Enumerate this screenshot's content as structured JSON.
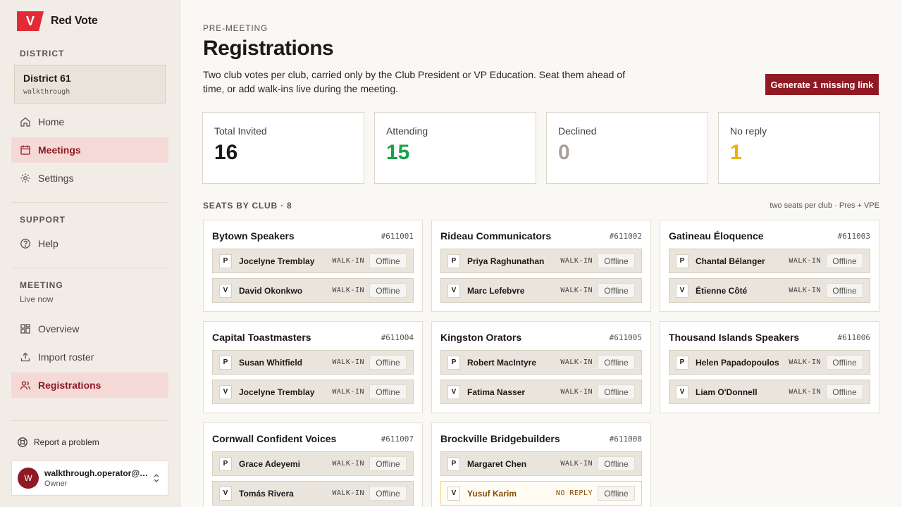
{
  "brand": {
    "logo_letter": "V",
    "name": "Red Vote",
    "color": "#e32b37"
  },
  "sidebar": {
    "district_label": "DISTRICT",
    "district": {
      "name": "District 61",
      "sub": "walkthrough"
    },
    "nav": [
      {
        "label": "Home",
        "icon": "home-icon"
      },
      {
        "label": "Meetings",
        "icon": "calendar-icon",
        "active": true
      },
      {
        "label": "Settings",
        "icon": "gear-icon"
      }
    ],
    "support_label": "SUPPORT",
    "support": [
      {
        "label": "Help",
        "icon": "help-icon"
      }
    ],
    "meeting_label": "MEETING",
    "meeting_status": "Live now",
    "meeting": [
      {
        "label": "Overview",
        "icon": "grid-icon"
      },
      {
        "label": "Import roster",
        "icon": "upload-icon"
      },
      {
        "label": "Registrations",
        "icon": "users-icon",
        "active": true
      }
    ],
    "report": "Report a problem",
    "user": {
      "initial": "W",
      "email": "walkthrough.operator@tally.example",
      "role": "Owner"
    }
  },
  "main": {
    "pre": "PRE-MEETING",
    "title": "Registrations",
    "desc": "Two club votes per club, carried only by the Club President or VP Education. Seat them ahead of time, or add walk-ins live during the meeting.",
    "generate_button": "Generate 1 missing link",
    "stats": [
      {
        "label": "Total Invited",
        "value": "16",
        "color": "#1c1917"
      },
      {
        "label": "Attending",
        "value": "15",
        "color": "#16a34a"
      },
      {
        "label": "Declined",
        "value": "0",
        "color": "#a8a29e"
      },
      {
        "label": "No reply",
        "value": "1",
        "color": "#eab308"
      }
    ],
    "seats_heading": "SEATS BY CLUB · 8",
    "seats_note": "two seats per club · Pres + VPE",
    "clubs": [
      {
        "name": "Bytown Speakers",
        "id": "#611001",
        "seats": [
          {
            "role": "P",
            "name": "Jocelyne Tremblay",
            "status": "WALK-IN",
            "conn": "Offline"
          },
          {
            "role": "V",
            "name": "David Okonkwo",
            "status": "WALK-IN",
            "conn": "Offline"
          }
        ]
      },
      {
        "name": "Rideau Communicators",
        "id": "#611002",
        "seats": [
          {
            "role": "P",
            "name": "Priya Raghunathan",
            "status": "WALK-IN",
            "conn": "Offline"
          },
          {
            "role": "V",
            "name": "Marc Lefebvre",
            "status": "WALK-IN",
            "conn": "Offline"
          }
        ]
      },
      {
        "name": "Gatineau Éloquence",
        "id": "#611003",
        "seats": [
          {
            "role": "P",
            "name": "Chantal Bélanger",
            "status": "WALK-IN",
            "conn": "Offline"
          },
          {
            "role": "V",
            "name": "Étienne Côté",
            "status": "WALK-IN",
            "conn": "Offline"
          }
        ]
      },
      {
        "name": "Capital Toastmasters",
        "id": "#611004",
        "seats": [
          {
            "role": "P",
            "name": "Susan Whitfield",
            "status": "WALK-IN",
            "conn": "Offline"
          },
          {
            "role": "V",
            "name": "Jocelyne Tremblay",
            "status": "WALK-IN",
            "conn": "Offline"
          }
        ]
      },
      {
        "name": "Kingston Orators",
        "id": "#611005",
        "seats": [
          {
            "role": "P",
            "name": "Robert MacIntyre",
            "status": "WALK-IN",
            "conn": "Offline"
          },
          {
            "role": "V",
            "name": "Fatima Nasser",
            "status": "WALK-IN",
            "conn": "Offline"
          }
        ]
      },
      {
        "name": "Thousand Islands Speakers",
        "id": "#611006",
        "seats": [
          {
            "role": "P",
            "name": "Helen Papadopoulos",
            "status": "WALK-IN",
            "conn": "Offline"
          },
          {
            "role": "V",
            "name": "Liam O'Donnell",
            "status": "WALK-IN",
            "conn": "Offline"
          }
        ]
      },
      {
        "name": "Cornwall Confident Voices",
        "id": "#611007",
        "seats": [
          {
            "role": "P",
            "name": "Grace Adeyemi",
            "status": "WALK-IN",
            "conn": "Offline"
          },
          {
            "role": "V",
            "name": "Tomás Rivera",
            "status": "WALK-IN",
            "conn": "Offline"
          }
        ]
      },
      {
        "name": "Brockville Bridgebuilders",
        "id": "#611008",
        "seats": [
          {
            "role": "P",
            "name": "Margaret Chen",
            "status": "WALK-IN",
            "conn": "Offline"
          },
          {
            "role": "V",
            "name": "Yusuf Karim",
            "status": "NO REPLY",
            "conn": "Offline",
            "noreply": true
          }
        ]
      }
    ]
  }
}
